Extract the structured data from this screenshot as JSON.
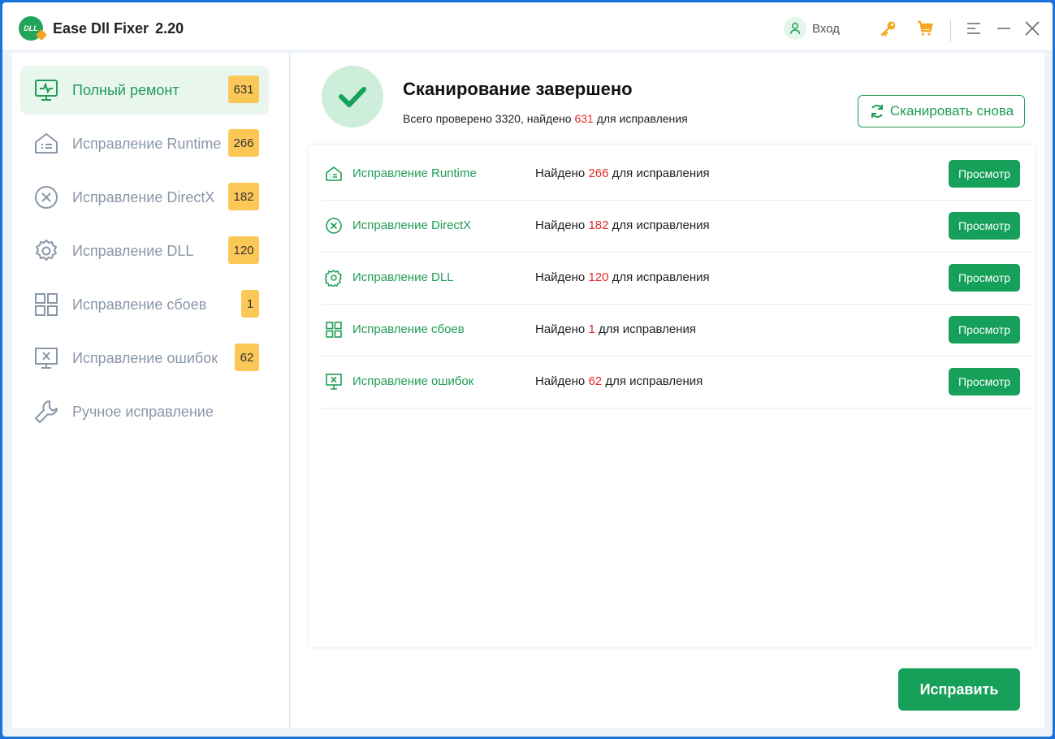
{
  "app": {
    "logo_text": "DLL",
    "title": "Ease Dll Fixer",
    "version": "2.20"
  },
  "titlebar": {
    "login_label": "Вход"
  },
  "sidebar": {
    "items": [
      {
        "label": "Полный ремонт",
        "badge": "631",
        "icon": "monitor-pulse-icon"
      },
      {
        "label": "Исправление Runtime",
        "badge": "266",
        "icon": "runtime-icon"
      },
      {
        "label": "Исправление DirectX",
        "badge": "182",
        "icon": "circle-x-icon"
      },
      {
        "label": "Исправление DLL",
        "badge": "120",
        "icon": "gear-icon"
      },
      {
        "label": "Исправление сбоев",
        "badge": "1",
        "icon": "grid-icon"
      },
      {
        "label": "Исправление ошибок",
        "badge": "62",
        "icon": "monitor-x-icon"
      },
      {
        "label": "Ручное исправление",
        "icon": "wrench-icon"
      }
    ]
  },
  "summary": {
    "title": "Сканирование завершено",
    "sub_prefix": "Всего проверено 3320, найдено",
    "sub_count": "631",
    "sub_suffix": "для исправления",
    "rescan_label": "Сканировать снова"
  },
  "results": [
    {
      "name": "Исправление Runtime",
      "found_prefix": "Найдено",
      "count": "266",
      "found_suffix": "для исправления",
      "button": "Просмотр"
    },
    {
      "name": "Исправление DirectX",
      "found_prefix": "Найдено",
      "count": "182",
      "found_suffix": "для исправления",
      "button": "Просмотр"
    },
    {
      "name": "Исправление DLL",
      "found_prefix": "Найдено",
      "count": "120",
      "found_suffix": "для исправления",
      "button": "Просмотр"
    },
    {
      "name": "Исправление сбоев",
      "found_prefix": "Найдено",
      "count": "1",
      "found_suffix": "для исправления",
      "button": "Просмотр"
    },
    {
      "name": "Исправление ошибок",
      "found_prefix": "Найдено",
      "count": "62",
      "found_suffix": "для исправления",
      "button": "Просмотр"
    }
  ],
  "fix_button": "Исправить",
  "colors": {
    "accent": "#16a05a",
    "badge": "#fbc858",
    "highlight": "#e02b2b",
    "frame": "#1a73d9"
  }
}
